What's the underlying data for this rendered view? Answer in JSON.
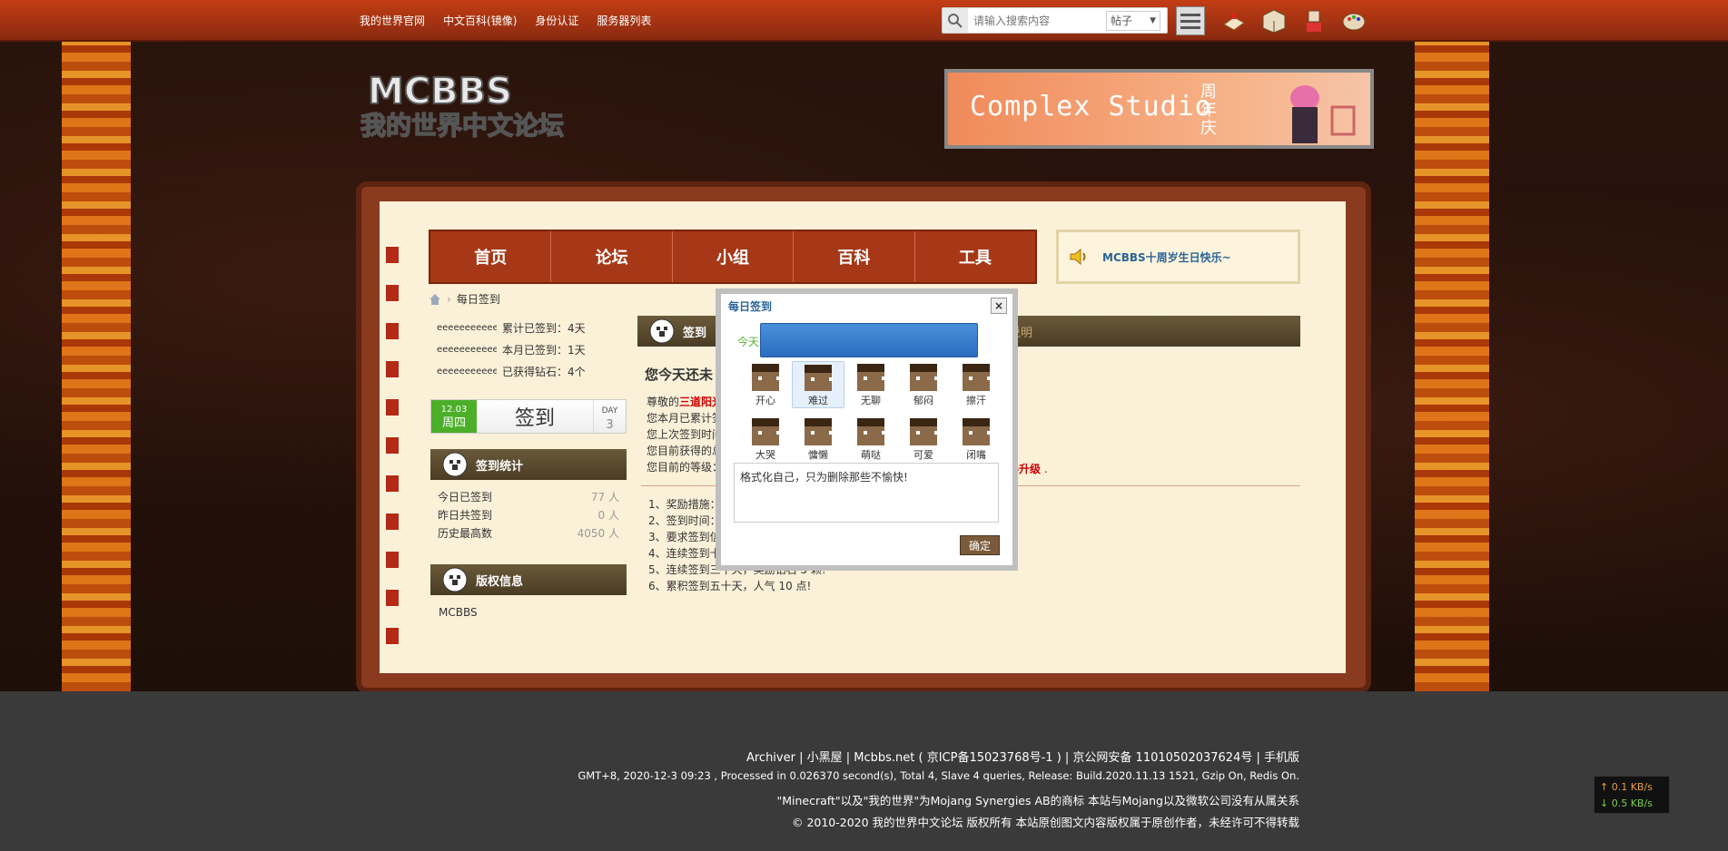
{
  "topbar": {
    "links": [
      "我的世界官网",
      "中文百科(镜像)",
      "身份认证",
      "服务器列表"
    ],
    "search_placeholder": "请输入搜索内容",
    "search_scope": "帖子"
  },
  "banner": {
    "text": "Complex Studio",
    "subtitle": "周年庆"
  },
  "nav": {
    "items": [
      "首页",
      "论坛",
      "小组",
      "百科",
      "工具"
    ]
  },
  "notice": {
    "text": "MCBBS十周岁生日快乐~"
  },
  "breadcrumb": {
    "current": "每日签到"
  },
  "left_stats": [
    {
      "name": "eeeeeeeeeeee",
      "label": "累计已签到：4天"
    },
    {
      "name": "eeeeeeeeeeee",
      "label": "本月已签到：1天"
    },
    {
      "name": "eeeeeeeeeeee",
      "label": "已获得钻石：4个"
    }
  ],
  "signbar": {
    "date": "12.03",
    "weekday": "周四",
    "label": "签到",
    "day_label": "DAY",
    "day_value": "3"
  },
  "sign_stats": {
    "title": "签到统计",
    "rows": [
      {
        "label": "今日已签到",
        "value": "77 人"
      },
      {
        "label": "昨日共签到",
        "value": "0 人"
      },
      {
        "label": "历史最高数",
        "value": "4050 人"
      }
    ]
  },
  "copyright": {
    "title": "版权信息",
    "text": "MCBBS"
  },
  "main": {
    "header_fragment": "签到",
    "header_right": "及说明",
    "title": "您今天还未",
    "lines": [
      "尊敬的",
      "您本月已累计签",
      "您上次签到时间",
      "您目前获得的总",
      "您目前的等级："
    ],
    "user": "三道阳光",
    "upgrade": "得升级",
    "rules": [
      "1、奖励措施：",
      "2、签到时间：",
      "3、要求签到信",
      "4、连续签到十",
      "5、连续签到三十天，奖励钻石 5 颗!",
      "6、累积签到五十天，人气 10 点!"
    ]
  },
  "modal": {
    "title": "每日签到",
    "close": "×",
    "green_text": "今天",
    "moods": [
      "开心",
      "难过",
      "无聊",
      "郁闷",
      "擦汗",
      "大哭",
      "慵懒",
      "萌哒",
      "可爱",
      "闭嘴"
    ],
    "selected_mood": "难过",
    "message": "格式化自己，只为删除那些不愉快!",
    "ok": "确定"
  },
  "footer": {
    "line1_links": "Archiver | 小黑屋 | Mcbbs.net ( 京ICP备15023768号-1 ) | 京公网安备 11010502037624号 | 手机版",
    "line2": "GMT+8, 2020-12-3 09:23 , Processed in 0.026370 second(s), Total 4, Slave 4 queries, Release: Build.2020.11.13 1521, Gzip On, Redis On.",
    "line3": "\"Minecraft\"以及\"我的世界\"为Mojang Synergies AB的商标 本站与Mojang以及微软公司没有从属关系",
    "line4": "© 2010-2020 我的世界中文论坛 版权所有 本站原创图文内容版权属于原创作者，未经许可不得转载"
  },
  "net": {
    "up": "↑ 0.1 KB/s",
    "down": "↓ 0.5 KB/s"
  }
}
